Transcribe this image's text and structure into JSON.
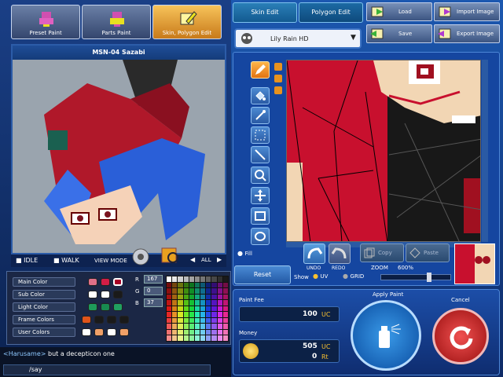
{
  "tabs": {
    "preset": "Preset Paint",
    "parts": "Parts Paint",
    "skin": "Skin, Polygon Edit"
  },
  "model_title": "MSN-04 Sazabi",
  "view": {
    "idle": "IDLE",
    "walk": "WALK",
    "mode": "VIEW MODE",
    "all": "ALL"
  },
  "colors": {
    "main": "Main Color",
    "sub": "Sub Color",
    "light": "Light Color",
    "frame": "Frame Colors",
    "user": "User Colors"
  },
  "rgb": {
    "r_label": "R",
    "g_label": "G",
    "b_label": "B",
    "r": "167",
    "g": "0",
    "b": "37"
  },
  "chat": {
    "name": "<Harusame>",
    "message": "but a decepticon one",
    "input": "/say"
  },
  "edit_tabs": {
    "skin": "Skin Edit",
    "polygon": "Polygon Edit"
  },
  "file": {
    "load": "Load",
    "save": "Save",
    "import": "Import Image",
    "export": "Export Image"
  },
  "skin_select": "Lily Rain HD",
  "fill_label": "Fill",
  "undo": "UNDO",
  "redo": "REDO",
  "copy": "Copy",
  "paste": "Paste",
  "zoom_label": "ZOOM",
  "zoom_value": "600%",
  "reset": "Reset",
  "show": "Show",
  "uv": "UV",
  "grid": "GRID",
  "paint_fee_label": "Paint Fee",
  "paint_fee_value": "100",
  "uc": "UC",
  "money_label": "Money",
  "money_uc": "505",
  "money_rt": "0",
  "rt": "Rt",
  "apply_paint": "Apply Paint",
  "cancel": "Cancel"
}
